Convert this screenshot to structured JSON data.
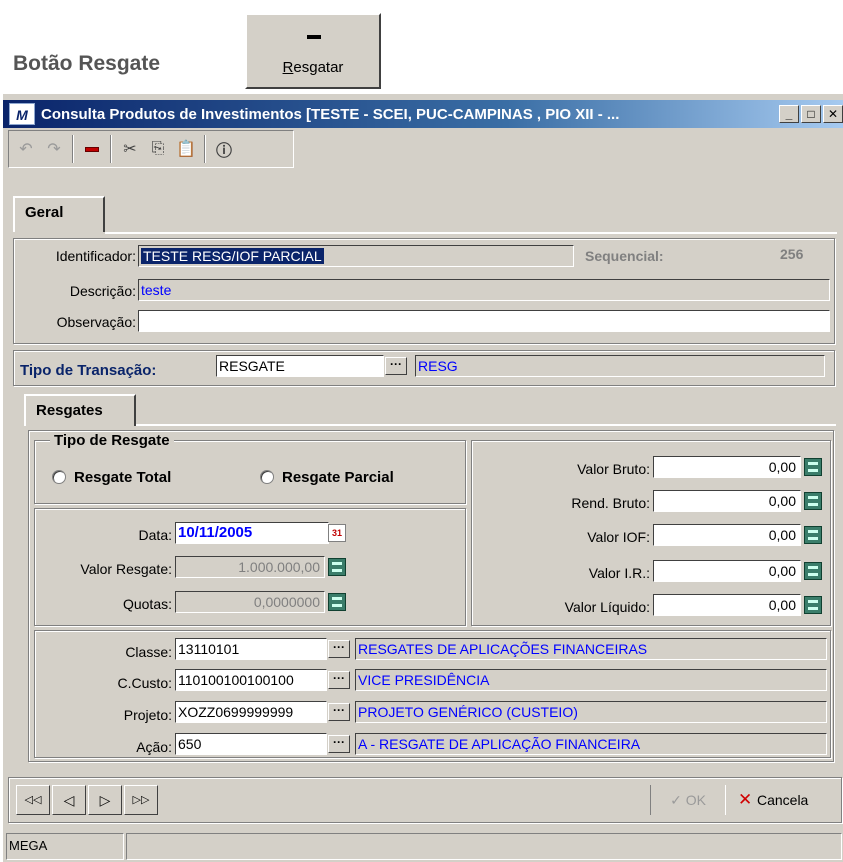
{
  "caption": {
    "text": "Botão Resgate"
  },
  "demo_button": {
    "label": "Resgatar",
    "icon": "minus-icon"
  },
  "window": {
    "logo_text": "M",
    "title": "Consulta Produtos de Investimentos [TESTE - SCEI, PUC-CAMPINAS , PIO XII - ...",
    "controls": [
      "_",
      "□",
      "✕"
    ]
  },
  "toolbar": {
    "icons": [
      "undo-icon",
      "redo-icon",
      "delete-icon",
      "cut-icon",
      "copy-icon",
      "paste-icon",
      "info-icon"
    ]
  },
  "tabs": {
    "main": "Geral",
    "sub": "Resgates"
  },
  "general": {
    "identificador_label": "Identificador:",
    "identificador_value": "TESTE RESG/IOF PARCIAL",
    "sequencial_label": "Sequencial:",
    "sequencial_value": "256",
    "descricao_label": "Descrição:",
    "descricao_value": "teste",
    "observacao_label": "Observação:",
    "observacao_value": ""
  },
  "transaction": {
    "label": "Tipo de Transação:",
    "value": "RESGATE",
    "code": "RESG"
  },
  "redemption_type": {
    "legend": "Tipo de Resgate",
    "options": [
      "Resgate Total",
      "Resgate Parcial"
    ]
  },
  "redemption": {
    "data_label": "Data:",
    "data_value": "10/11/2005",
    "valor_label": "Valor Resgate:",
    "valor_value": "1.000.000,00",
    "quotas_label": "Quotas:",
    "quotas_value": "0,0000000"
  },
  "values": [
    {
      "label": "Valor Bruto:",
      "value": "0,00"
    },
    {
      "label": "Rend. Bruto:",
      "value": "0,00"
    },
    {
      "label": "Valor IOF:",
      "value": "0,00"
    },
    {
      "label": "Valor I.R.:",
      "value": "0,00"
    },
    {
      "label": "Valor Líquido:",
      "value": "0,00"
    }
  ],
  "accounting": [
    {
      "label": "Classe:",
      "code": "13110101",
      "desc": "RESGATES DE APLICAÇÕES FINANCEIRAS"
    },
    {
      "label": "C.Custo:",
      "code": "110100100100100",
      "desc": "VICE PRESIDÊNCIA"
    },
    {
      "label": "Projeto:",
      "code": "XOZZ0699999999",
      "desc": "PROJETO GENÉRICO (CUSTEIO)"
    },
    {
      "label": "Ação:",
      "code": "650",
      "desc": "A - RESGATE DE APLICAÇÃO FINANCEIRA"
    }
  ],
  "nav": {
    "first": "◁◁",
    "prev": "◁",
    "next": "▷",
    "last": "▷▷",
    "ok_label": "OK",
    "cancel_label": "Cancela"
  },
  "status": {
    "text": "MEGA"
  }
}
